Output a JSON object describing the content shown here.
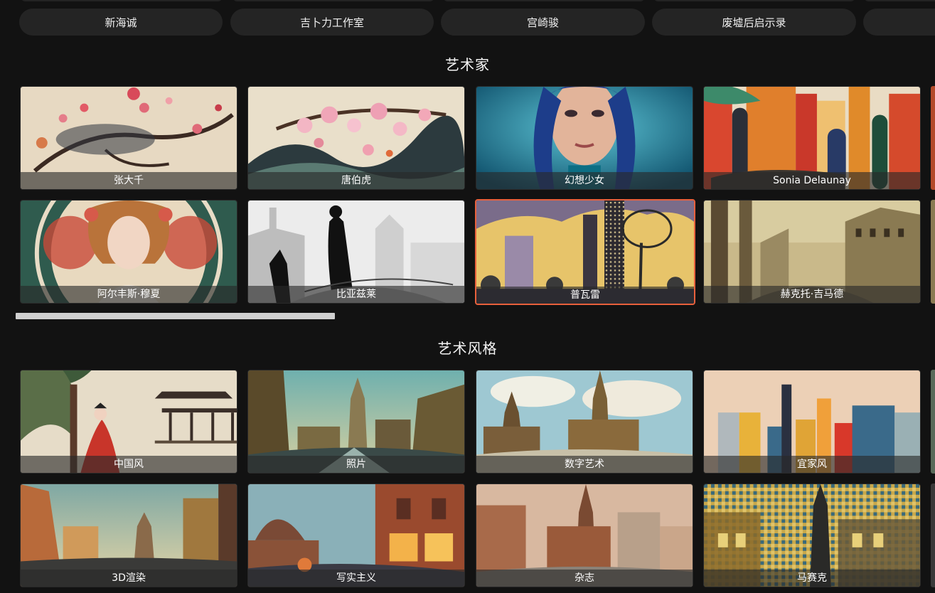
{
  "categories_row": {
    "items": [
      {
        "label": "新海诚"
      },
      {
        "label": "吉卜力工作室"
      },
      {
        "label": "宫崎骏"
      },
      {
        "label": "废墟后启示录"
      },
      {
        "label": ""
      }
    ]
  },
  "artists": {
    "title": "艺术家",
    "cards": [
      {
        "label": "张大千"
      },
      {
        "label": "唐伯虎"
      },
      {
        "label": "幻想少女"
      },
      {
        "label": "Sonia Delaunay"
      },
      {
        "label": "阿尔丰斯·穆夏"
      },
      {
        "label": "比亚兹莱"
      },
      {
        "label": "普瓦雷",
        "selected": true
      },
      {
        "label": "赫克托·吉马德"
      }
    ]
  },
  "styles": {
    "title": "艺术风格",
    "cards": [
      {
        "label": "中国风"
      },
      {
        "label": "照片"
      },
      {
        "label": "数字艺术"
      },
      {
        "label": "宜家风"
      },
      {
        "label": "3D渲染"
      },
      {
        "label": "写实主义"
      },
      {
        "label": "杂志"
      },
      {
        "label": "马赛克"
      }
    ]
  },
  "colors": {
    "background": "#121212",
    "pill": "#242424",
    "selected_border": "#e8603c",
    "scrollbar": "#cfcfcf"
  }
}
